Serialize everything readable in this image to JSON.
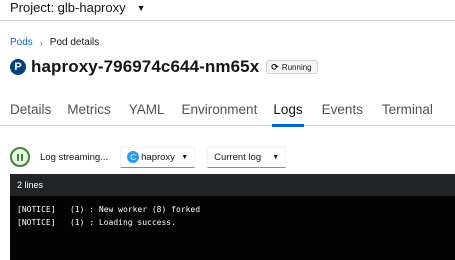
{
  "project": {
    "label": "Project: glb-haproxy"
  },
  "breadcrumb": {
    "parent": "Pods",
    "current": "Pod details"
  },
  "pod": {
    "badge": "P",
    "name": "haproxy-796974c644-nm65x",
    "status": "Running"
  },
  "tabs": [
    {
      "label": "Details"
    },
    {
      "label": "Metrics"
    },
    {
      "label": "YAML"
    },
    {
      "label": "Environment"
    },
    {
      "label": "Logs",
      "active": true
    },
    {
      "label": "Events"
    },
    {
      "label": "Terminal"
    }
  ],
  "log_toolbar": {
    "streaming_label": "Log streaming...",
    "container_badge": "C",
    "container_selected": "haproxy",
    "log_selected": "Current log"
  },
  "log": {
    "line_count": "2 lines",
    "lines": [
      "[NOTICE]   (1) : New worker (8) forked",
      "[NOTICE]   (1) : Loading success."
    ]
  },
  "colors": {
    "accent": "#0066cc",
    "pod_badge": "#004080",
    "streaming": "#3e8635",
    "container_badge": "#2b9af3",
    "log_bg": "#030303"
  },
  "icons": [
    "caret-down-icon",
    "chevron-right-icon",
    "sync-icon",
    "pause-icon"
  ]
}
